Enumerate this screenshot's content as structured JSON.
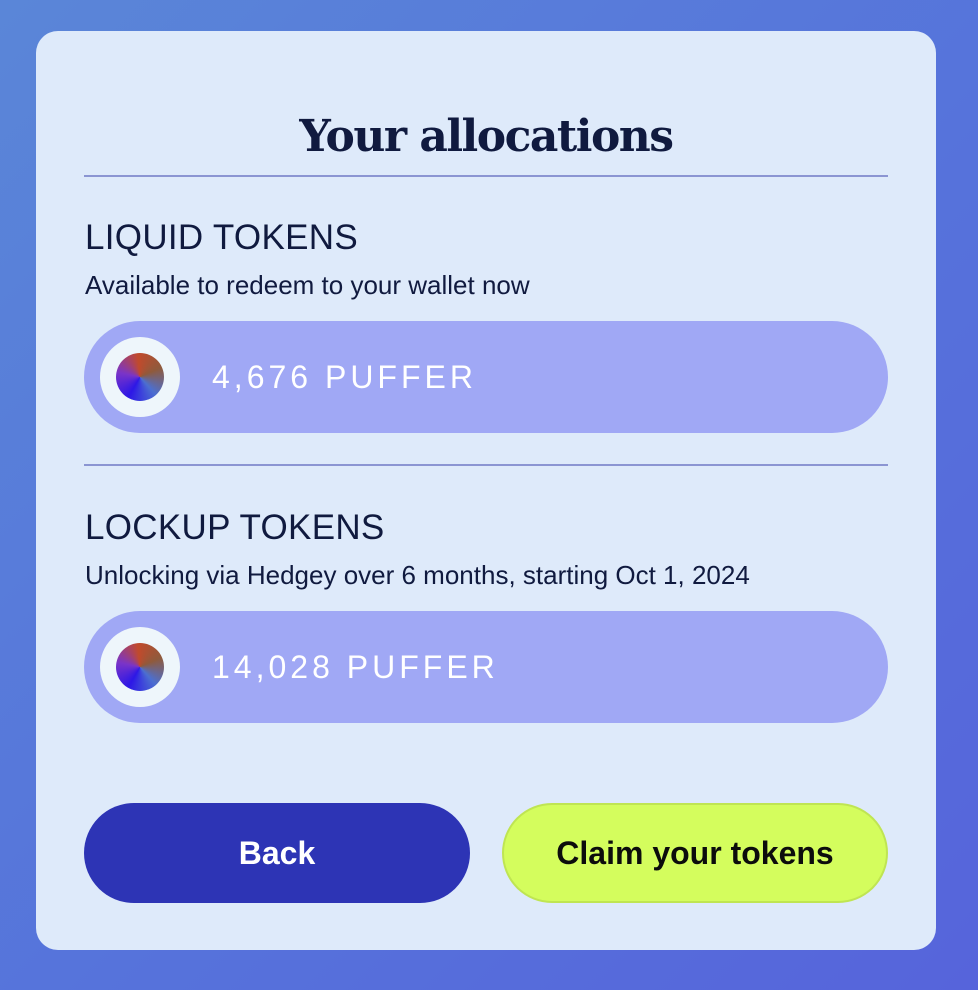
{
  "card": {
    "title": "Your allocations"
  },
  "liquid": {
    "heading": "LIQUID TOKENS",
    "description": "Available to redeem to your wallet now",
    "amount": "4,676 PUFFER",
    "token_icon": "puffer-token-icon"
  },
  "lockup": {
    "heading": "LOCKUP TOKENS",
    "description": "Unlocking via Hedgey over 6 months, starting Oct 1, 2024",
    "amount": "14,028 PUFFER",
    "token_icon": "puffer-token-icon"
  },
  "actions": {
    "back_label": "Back",
    "claim_label": "Claim your tokens"
  },
  "colors": {
    "background": "#5673db",
    "card": "#deeafa",
    "pill": "#a0a8f5",
    "back_button": "#2d34b5",
    "claim_button": "#d4fd5d",
    "text_dark": "#101a3f"
  }
}
